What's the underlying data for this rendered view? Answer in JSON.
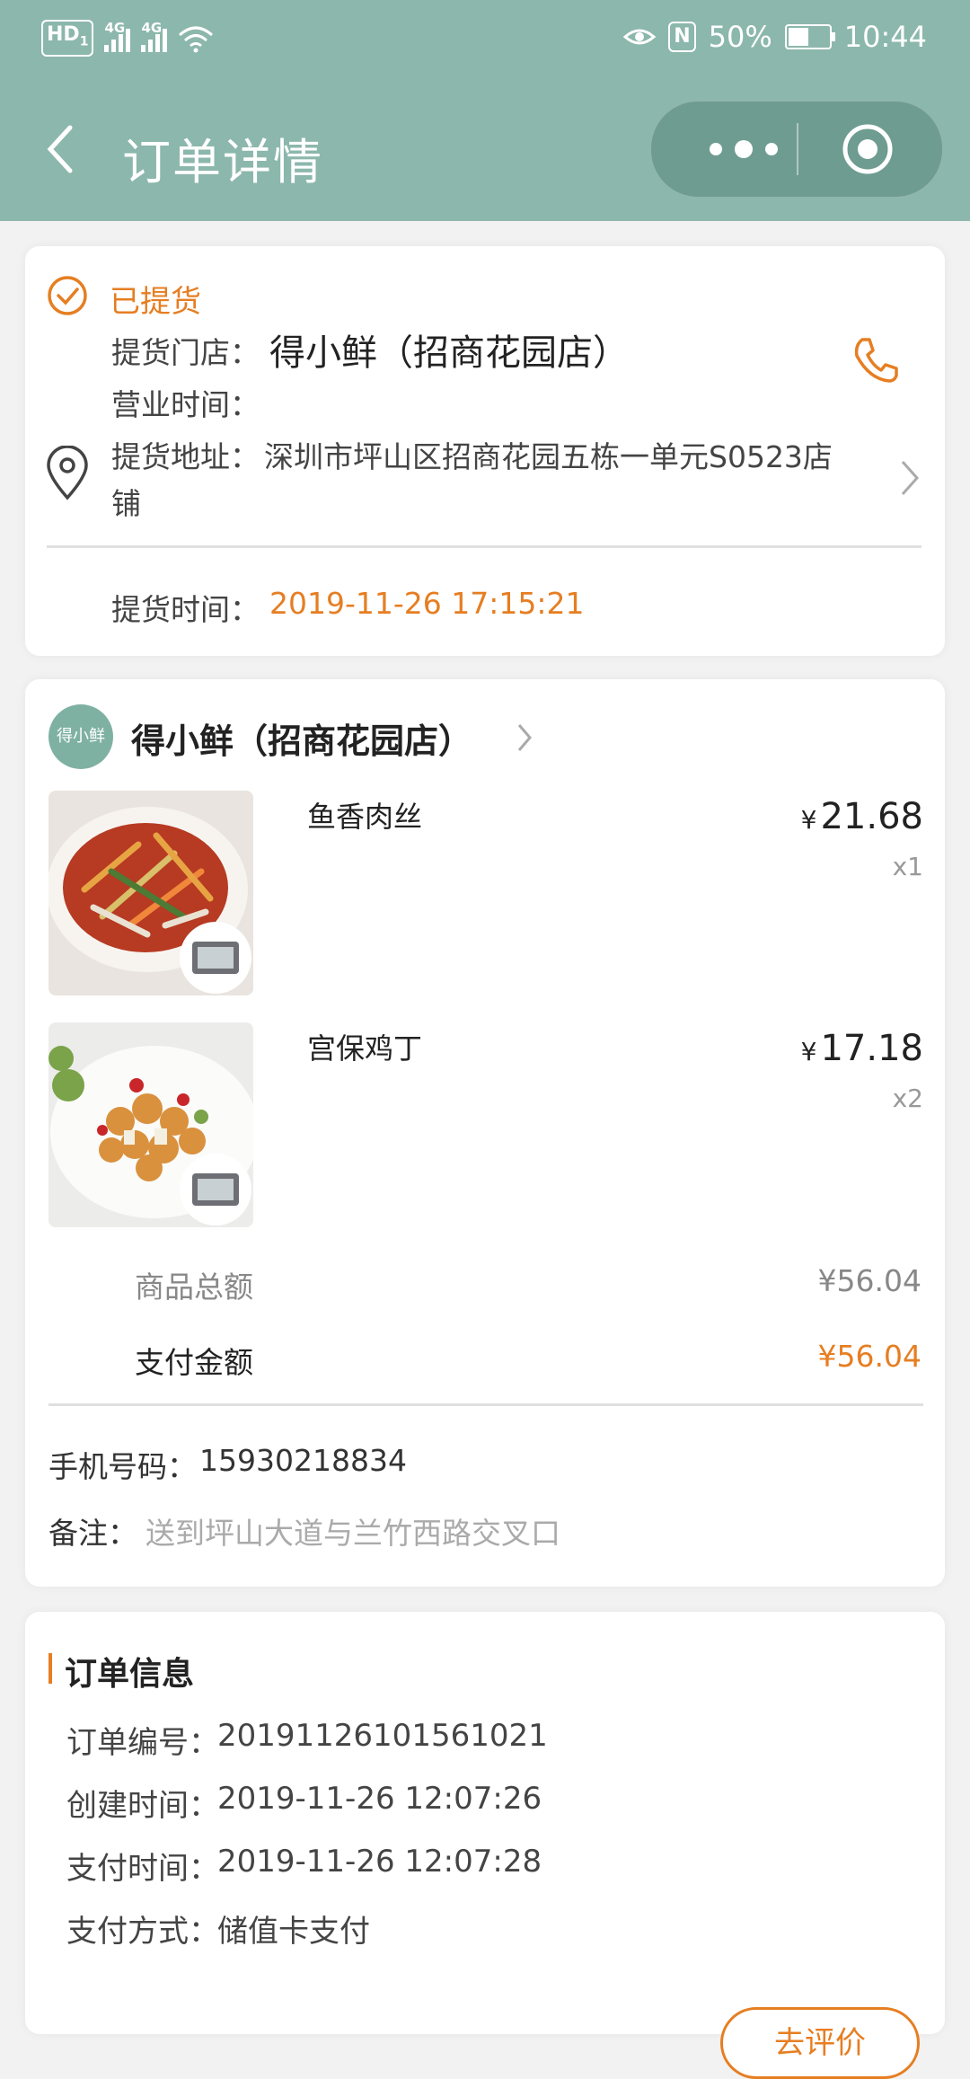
{
  "status_bar": {
    "hd": "HD",
    "hd_sub": "1",
    "net1": "4G",
    "net2": "4G",
    "nfc": "N",
    "battery_pct": "50%",
    "battery_level": 0.5,
    "time": "10:44"
  },
  "nav": {
    "title": "订单详情"
  },
  "pickup": {
    "status": "已提货",
    "store_label": "提货门店：",
    "store_name": "得小鲜（招商花园店）",
    "hours_label": "营业时间：",
    "hours_value": "",
    "address_label": "提货地址：",
    "address_line1": "深圳市坪山区招商花园五栋一单元S0523店",
    "address_line2": "铺",
    "time_label": "提货时间：",
    "time_value": "2019-11-26 17:15:21"
  },
  "shop": {
    "logo_text": "得小鲜",
    "name": "得小鲜（招商花园店）"
  },
  "items": [
    {
      "name": "鱼香肉丝",
      "currency": "¥",
      "price": "21.68",
      "qty": "x1"
    },
    {
      "name": "宫保鸡丁",
      "currency": "¥",
      "price": "17.18",
      "qty": "x2"
    }
  ],
  "totals": {
    "goods_label": "商品总额",
    "goods_value": "¥56.04",
    "paid_label": "支付金额",
    "paid_value": "¥56.04"
  },
  "contact": {
    "phone_label": "手机号码：",
    "phone_value": "15930218834",
    "note_label": "备注：",
    "note_value": "送到坪山大道与兰竹西路交叉口"
  },
  "order_info": {
    "title": "订单信息",
    "rows": [
      {
        "label": "订单编号：",
        "value": "20191126101561021"
      },
      {
        "label": "创建时间：",
        "value": "2019-11-26 12:07:26"
      },
      {
        "label": "支付时间：",
        "value": "2019-11-26 12:07:28"
      },
      {
        "label": "支付方式：",
        "value": "储值卡支付"
      }
    ],
    "review_button": "去评价"
  },
  "colors": {
    "header": "#8cb7ac",
    "accent": "#e67e22"
  }
}
